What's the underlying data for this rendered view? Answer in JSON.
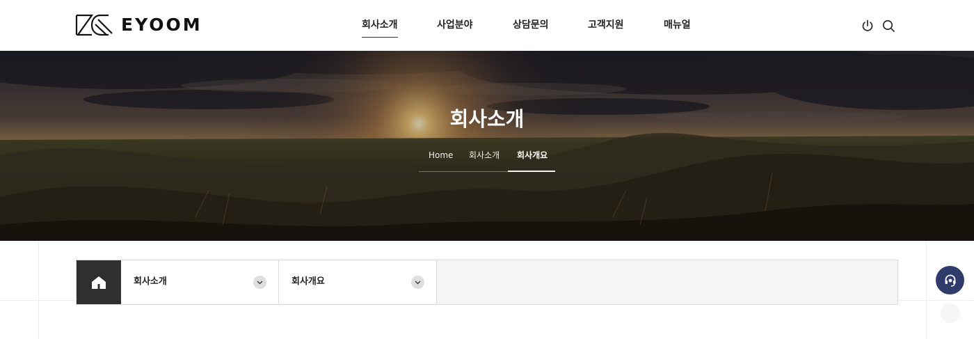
{
  "header": {
    "brand": "EYOOM",
    "nav": [
      {
        "label": "회사소개",
        "active": true
      },
      {
        "label": "사업분야",
        "active": false
      },
      {
        "label": "상담문의",
        "active": false
      },
      {
        "label": "고객지원",
        "active": false
      },
      {
        "label": "매뉴얼",
        "active": false
      }
    ],
    "icons": [
      "power-icon",
      "search-icon"
    ]
  },
  "hero": {
    "title": "회사소개",
    "breadcrumb": [
      "Home",
      "회사소개",
      "회사개요"
    ]
  },
  "subnav": {
    "home_icon": "home-icon",
    "level1": "회사소개",
    "level2": "회사개요"
  },
  "floating": {
    "icon": "headset-icon",
    "color": "#2e3b6b"
  },
  "colors": {
    "accent": "#2e3b6b",
    "home_bg": "#2f2f2f"
  }
}
